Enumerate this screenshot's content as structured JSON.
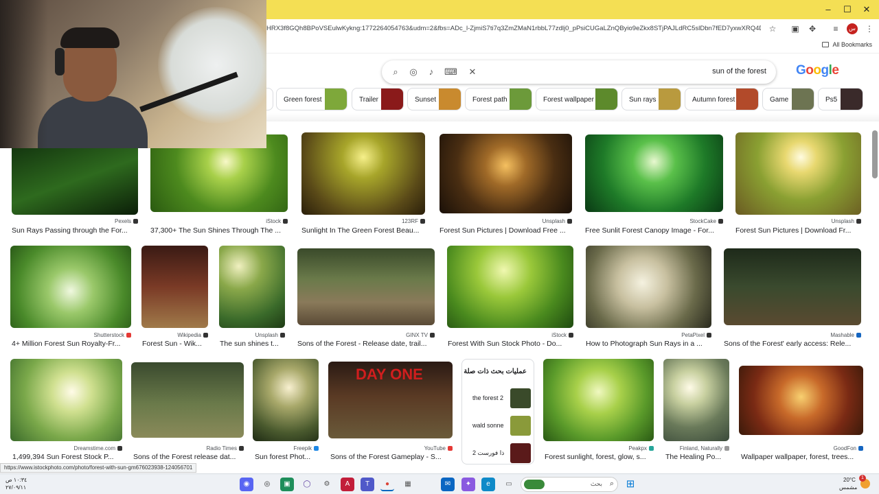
{
  "browser": {
    "url": "HRX3f8GQh8BPoVSEulwKykng:1772264054763&udm=2&fbs=ADc_l-ZjmiS7ti7q3ZmZMaN1rbbL77zdlj0_pPsiCUGaLZnQByio9eZkx8STjPAJLdRC5slDbn7fED7yxwXRQ4DPEB0PF...",
    "bookmarks_label": "All Bookmarks",
    "window_controls": [
      "–",
      "☐",
      "✕"
    ]
  },
  "search": {
    "query": "sun of the forest",
    "logo": "Google"
  },
  "chips": [
    {
      "label": "Green forest",
      "color": "#7ea83a"
    },
    {
      "label": "Trailer",
      "color": "#8a1a1a"
    },
    {
      "label": "Sunset",
      "color": "#c98a2e"
    },
    {
      "label": "Forest path",
      "color": "#6c9a3a"
    },
    {
      "label": "Forest wallpaper",
      "color": "#5d8a2c"
    },
    {
      "label": "Sun rays",
      "color": "#b99a3e"
    },
    {
      "label": "Autumn forest",
      "color": "#b24a2a"
    },
    {
      "label": "Game",
      "color": "#6d7452"
    },
    {
      "label": "Ps5",
      "color": "#3a2a2a"
    }
  ],
  "results": {
    "row1": [
      {
        "source": "Pexels",
        "title": "Sun Rays Passing through the For...",
        "color": "#1f4a16"
      },
      {
        "source": "iStock",
        "title": "37,300+ The Sun Shines Through The ...",
        "color": "#5d9a25"
      },
      {
        "source": "123RF",
        "title": "Sunlight In The Green Forest Beau...",
        "color": "#8f8a2e"
      },
      {
        "source": "Unsplash",
        "title": "Forest Sun Pictures | Download Free ...",
        "color": "#6a4a20"
      },
      {
        "source": "StockCake",
        "title": "Free Sunlit Forest Canopy Image - For...",
        "color": "#2f8a3a"
      },
      {
        "source": "Unsplash",
        "title": "Forest Sun Pictures | Download Fr...",
        "color": "#b9a84a"
      }
    ],
    "row2": [
      {
        "source": "Shutterstock",
        "title": "4+ Million Forest Sun Royalty-Fr...",
        "color": "#6a9a4a"
      },
      {
        "source": "Wikipedia",
        "title": "Forest Sun - Wik...",
        "color": "#5a2a1e"
      },
      {
        "source": "Unsplash",
        "title": "The sun shines t...",
        "color": "#6d8a4a"
      },
      {
        "source": "GINX TV",
        "title": "Sons of the Forest - Release date, trail...",
        "color": "#7a6a4e"
      },
      {
        "source": "iStock",
        "title": "Forest With Sun Stock Photo - Do...",
        "color": "#6f9a2a"
      },
      {
        "source": "PetaPixel",
        "title": "How to Photograph Sun Rays in a ...",
        "color": "#a49a7a"
      },
      {
        "source": "Mashable",
        "title": "Sons of the Forest' early access: Rele...",
        "color": "#3a3a2a"
      }
    ],
    "row3": [
      {
        "source": "Dreamstime.com",
        "title": "1,499,394 Sun Forest Stock P...",
        "color": "#8aaa5a"
      },
      {
        "source": "Radio Times",
        "title": "Sons of the Forest release dat...",
        "color": "#5a6a3e"
      },
      {
        "source": "Freepik",
        "title": "Sun forest Phot...",
        "color": "#7a8a4e"
      },
      {
        "source": "YouTube",
        "title": "Sons of the Forest Gameplay - S...",
        "color": "#5a3a2a"
      },
      {
        "source": "Peakpx",
        "title": "Forest sunlight, forest, glow, s...",
        "color": "#7aaa3a"
      },
      {
        "source": "Finland, Naturally",
        "title": "The Healing Po...",
        "color": "#9aaa8a"
      },
      {
        "source": "GoodFon",
        "title": "Wallpaper wallpaper, forest, trees...",
        "color": "#8a3a1a"
      }
    ]
  },
  "related": {
    "heading": "عمليات بحث ذات صلة",
    "items": [
      {
        "label": "the forest 2",
        "color": "#3a4a2a"
      },
      {
        "label": "wald sonne",
        "color": "#8a9a3a"
      },
      {
        "label": "ذا فورست 2",
        "color": "#5a1a1a"
      }
    ]
  },
  "status_url": "https://www.istockphoto.com/photo/forest-with-sun-gm676023938-124056701",
  "taskbar": {
    "search_placeholder": "بحث",
    "time": "١٠:٣٤ ص",
    "date": "٢٧/٠٩/١١",
    "weather_temp": "20°C",
    "weather_desc": "مشمس",
    "badge": "1"
  }
}
